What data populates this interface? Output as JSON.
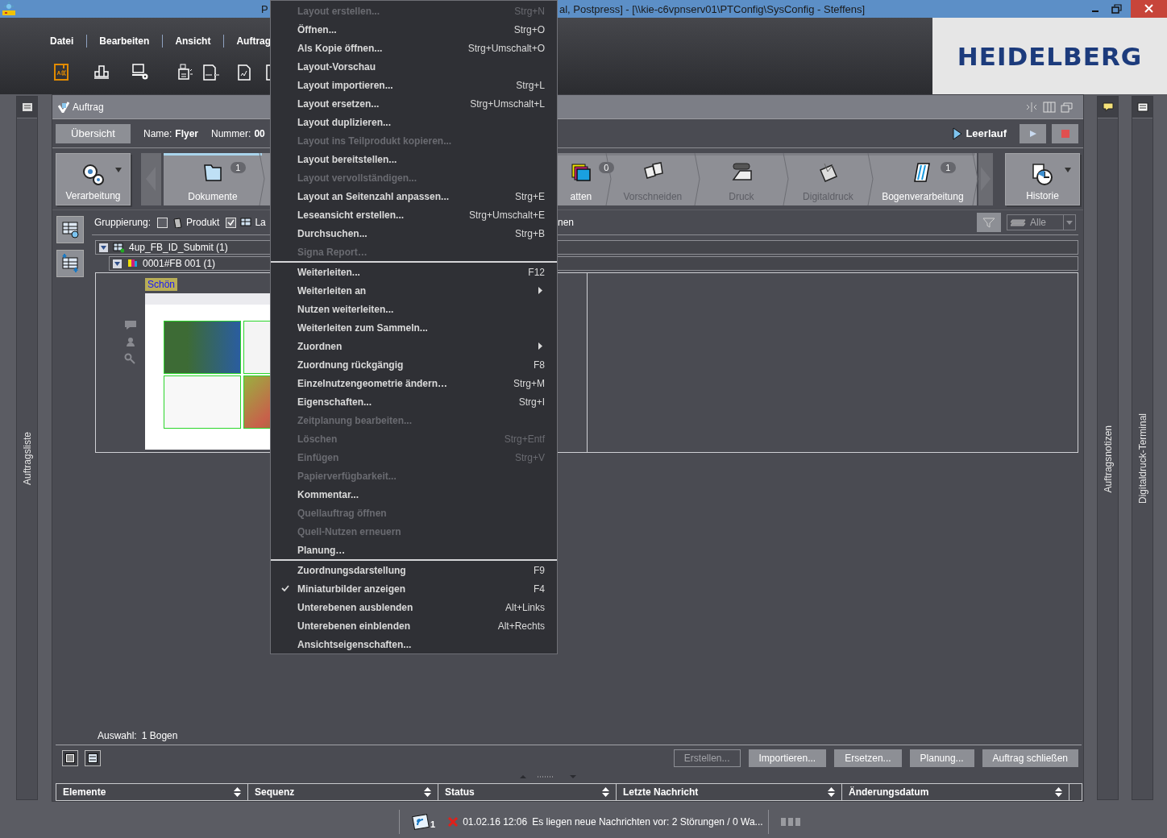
{
  "window": {
    "title_parts": [
      "P",
      "al, Postpress] - [\\\\kie-c6vpnserv01\\PTConfig\\SysConfig - Steffens]"
    ]
  },
  "menu_bar": [
    "Datei",
    "Bearbeiten",
    "Ansicht",
    "Auftrag"
  ],
  "logo": "HEIDELBERG",
  "left_sidebar": {
    "label": "Auftragsliste"
  },
  "right_sidebars": [
    {
      "label": "Auftragsnotizen"
    },
    {
      "label": "Digitaldruck-Terminal"
    }
  ],
  "panel": {
    "title": "Auftrag",
    "overview_button": "Übersicht",
    "name_label": "Name:",
    "name_value": "Flyer",
    "number_label": "Nummer:",
    "number_value": "00",
    "status": "Leerlauf"
  },
  "processing": {
    "label": "Verarbeitung"
  },
  "stages_left": [
    {
      "label": "Dokumente",
      "badge": "1",
      "active": true,
      "selected": true
    }
  ],
  "stages_right": [
    {
      "label": "atten",
      "badge": "0",
      "active": true,
      "selected": false
    },
    {
      "label": "Vorschneiden",
      "active": false,
      "selected": false
    },
    {
      "label": "Druck",
      "active": false,
      "selected": false
    },
    {
      "label": "Digitaldruck",
      "active": false,
      "selected": false
    },
    {
      "label": "Bogenverarbeitung",
      "badge": "1",
      "active": true,
      "selected": false
    }
  ],
  "history": {
    "label": "Historie"
  },
  "grouping": {
    "label": "Gruppierung:",
    "options": [
      {
        "label": "Produkt",
        "checked": false
      },
      {
        "label": "La",
        "checked": true
      }
    ],
    "right_text": "nen",
    "filter": "Alle"
  },
  "tree": [
    {
      "label": "4up_FB_ID_Submit (1)",
      "expanded": true,
      "children": [
        {
          "label": "0001#FB 001 (1)",
          "expanded": true
        }
      ]
    }
  ],
  "sheet": {
    "side": "Schön"
  },
  "selection": {
    "label": "Auswahl:",
    "value": "1 Bogen"
  },
  "actions": [
    {
      "label": "Erstellen...",
      "disabled": true
    },
    {
      "label": "Importieren...",
      "disabled": false
    },
    {
      "label": "Ersetzen...",
      "disabled": false
    },
    {
      "label": "Planung...",
      "disabled": false
    },
    {
      "label": "Auftrag schließen",
      "disabled": false
    }
  ],
  "table": {
    "columns": [
      "Elemente",
      "Sequenz",
      "Status",
      "Letzte Nachricht",
      "Änderungsdatum"
    ]
  },
  "status_bar": {
    "notifications": "1",
    "time": "01.02.16 12:06",
    "message": "Es liegen neue Nachrichten vor: 2 Störungen / 0 Wa..."
  },
  "context_menu": {
    "sections": [
      [
        {
          "label": "Layout erstellen...",
          "shortcut": "Strg+N",
          "disabled": true,
          "checked": false,
          "submenu": false
        },
        {
          "label": "Öffnen...",
          "shortcut": "Strg+O",
          "disabled": false,
          "checked": false,
          "submenu": false
        },
        {
          "label": "Als Kopie öffnen...",
          "shortcut": "Strg+Umschalt+O",
          "disabled": false,
          "checked": false,
          "submenu": false
        },
        {
          "label": "Layout-Vorschau",
          "disabled": false,
          "checked": false,
          "submenu": false
        },
        {
          "label": "Layout importieren...",
          "shortcut": "Strg+L",
          "disabled": false,
          "checked": false,
          "submenu": false
        },
        {
          "label": "Layout ersetzen...",
          "shortcut": "Strg+Umschalt+L",
          "disabled": false,
          "checked": false,
          "submenu": false
        },
        {
          "label": "Layout duplizieren...",
          "disabled": false,
          "checked": false,
          "submenu": false
        },
        {
          "label": "Layout ins Teilprodukt kopieren...",
          "disabled": true,
          "checked": false,
          "submenu": false
        },
        {
          "label": "Layout bereitstellen...",
          "disabled": false,
          "checked": false,
          "submenu": false
        },
        {
          "label": "Layout vervollständigen...",
          "disabled": true,
          "checked": false,
          "submenu": false
        },
        {
          "label": "Layout an Seitenzahl anpassen...",
          "shortcut": "Strg+E",
          "disabled": false,
          "checked": false,
          "submenu": false
        },
        {
          "label": "Leseansicht erstellen...",
          "shortcut": "Strg+Umschalt+E",
          "disabled": false,
          "checked": false,
          "submenu": false
        },
        {
          "label": "Durchsuchen...",
          "shortcut": "Strg+B",
          "disabled": false,
          "checked": false,
          "submenu": false
        },
        {
          "label": "Signa Report…",
          "disabled": true,
          "checked": false,
          "submenu": false
        }
      ],
      [
        {
          "label": "Weiterleiten...",
          "shortcut": "F12",
          "disabled": false,
          "checked": false,
          "submenu": false
        },
        {
          "label": "Weiterleiten an",
          "disabled": false,
          "checked": false,
          "submenu": true
        },
        {
          "label": "Nutzen weiterleiten...",
          "disabled": false,
          "checked": false,
          "submenu": false
        },
        {
          "label": "Weiterleiten zum Sammeln...",
          "disabled": false,
          "checked": false,
          "submenu": false
        },
        {
          "label": "Zuordnen",
          "disabled": false,
          "checked": false,
          "submenu": true
        },
        {
          "label": "Zuordnung rückgängig",
          "shortcut": "F8",
          "disabled": false,
          "checked": false,
          "submenu": false
        },
        {
          "label": "Einzelnutzengeometrie ändern…",
          "shortcut": "Strg+M",
          "disabled": false,
          "checked": false,
          "submenu": false
        },
        {
          "label": "Eigenschaften...",
          "shortcut": "Strg+I",
          "disabled": false,
          "checked": false,
          "submenu": false
        },
        {
          "label": "Zeitplanung bearbeiten...",
          "disabled": true,
          "checked": false,
          "submenu": false
        },
        {
          "label": "Löschen",
          "shortcut": "Strg+Entf",
          "disabled": true,
          "checked": false,
          "submenu": false
        },
        {
          "label": "Einfügen",
          "shortcut": "Strg+V",
          "disabled": true,
          "checked": false,
          "submenu": false
        },
        {
          "label": "Papierverfügbarkeit...",
          "disabled": true,
          "checked": false,
          "submenu": false
        },
        {
          "label": "Kommentar...",
          "disabled": false,
          "checked": false,
          "submenu": false
        },
        {
          "label": "Quellauftrag öffnen",
          "disabled": true,
          "checked": false,
          "submenu": false
        },
        {
          "label": "Quell-Nutzen erneuern",
          "disabled": true,
          "checked": false,
          "submenu": false
        },
        {
          "label": "Planung…",
          "disabled": false,
          "checked": false,
          "submenu": false
        }
      ],
      [
        {
          "label": "Zuordnungsdarstellung",
          "shortcut": "F9",
          "disabled": false,
          "checked": false,
          "submenu": false
        },
        {
          "label": "Miniaturbilder anzeigen",
          "shortcut": "F4",
          "disabled": false,
          "checked": true,
          "submenu": false
        },
        {
          "label": "Unterebenen ausblenden",
          "shortcut": "Alt+Links",
          "disabled": false,
          "checked": false,
          "submenu": false
        },
        {
          "label": "Unterebenen einblenden",
          "shortcut": "Alt+Rechts",
          "disabled": false,
          "checked": false,
          "submenu": false
        },
        {
          "label": "Ansichtseigenschaften...",
          "disabled": false,
          "checked": false,
          "submenu": false
        }
      ]
    ]
  }
}
